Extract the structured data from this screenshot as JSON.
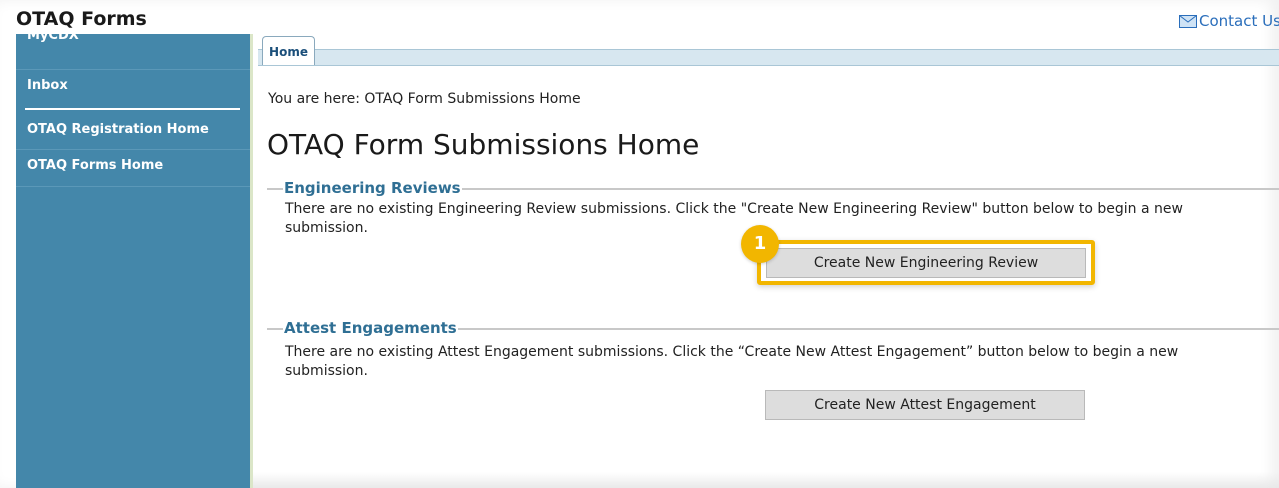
{
  "header": {
    "app_title": "OTAQ Forms",
    "contact_label": "Contact Us"
  },
  "sidebar": {
    "items": [
      {
        "label": "MyCDX"
      },
      {
        "label": "Inbox"
      },
      {
        "label": "OTAQ Registration Home"
      },
      {
        "label": "OTAQ Forms Home"
      }
    ]
  },
  "tabs": [
    {
      "label": "Home",
      "active": true
    }
  ],
  "breadcrumb": "You are here: OTAQ Form Submissions Home",
  "page_title": "OTAQ Form Submissions Home",
  "sections": {
    "engineering": {
      "heading": "Engineering Reviews",
      "text": "There are no existing Engineering Review submissions. Click the \"Create New Engineering Review\" button below to begin a new submission.",
      "button_label": "Create New Engineering Review"
    },
    "attest": {
      "heading": "Attest Engagements",
      "text": "There are no existing Attest Engagement submissions. Click the “Create New Attest Engagement” button below to begin a new submission.",
      "button_label": "Create New Attest Engagement"
    }
  },
  "callout": {
    "badge_number": "1",
    "color": "#f2b600"
  },
  "colors": {
    "sidebar_bg": "#4487aa",
    "link": "#2a6ebb",
    "section_heading": "#2f6f94"
  },
  "icons": {
    "contact": "mail-icon"
  }
}
